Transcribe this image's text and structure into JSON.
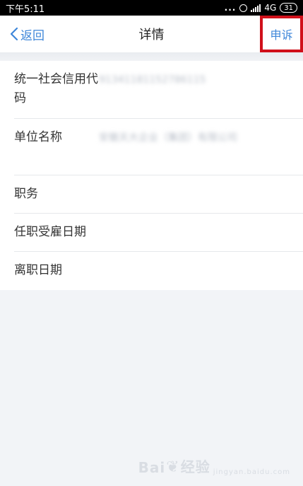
{
  "status_bar": {
    "time": "下午5:11",
    "dots": "...",
    "network": "4G",
    "battery": "31"
  },
  "nav": {
    "back_label": "返回",
    "title": "详情",
    "appeal_label": "申诉"
  },
  "details": [
    {
      "label": "统一社会信用代码",
      "value": "91341181152786115"
    },
    {
      "label": "单位名称",
      "value": "安徽天大企业（集团）有限公司"
    },
    {
      "label": "职务",
      "value": ""
    },
    {
      "label": "任职受雇日期",
      "value": ""
    },
    {
      "label": "离职日期",
      "value": ""
    }
  ],
  "watermark": {
    "brand": "Bai",
    "brand2": "经验",
    "sub": "jingyan.baidu.com"
  }
}
